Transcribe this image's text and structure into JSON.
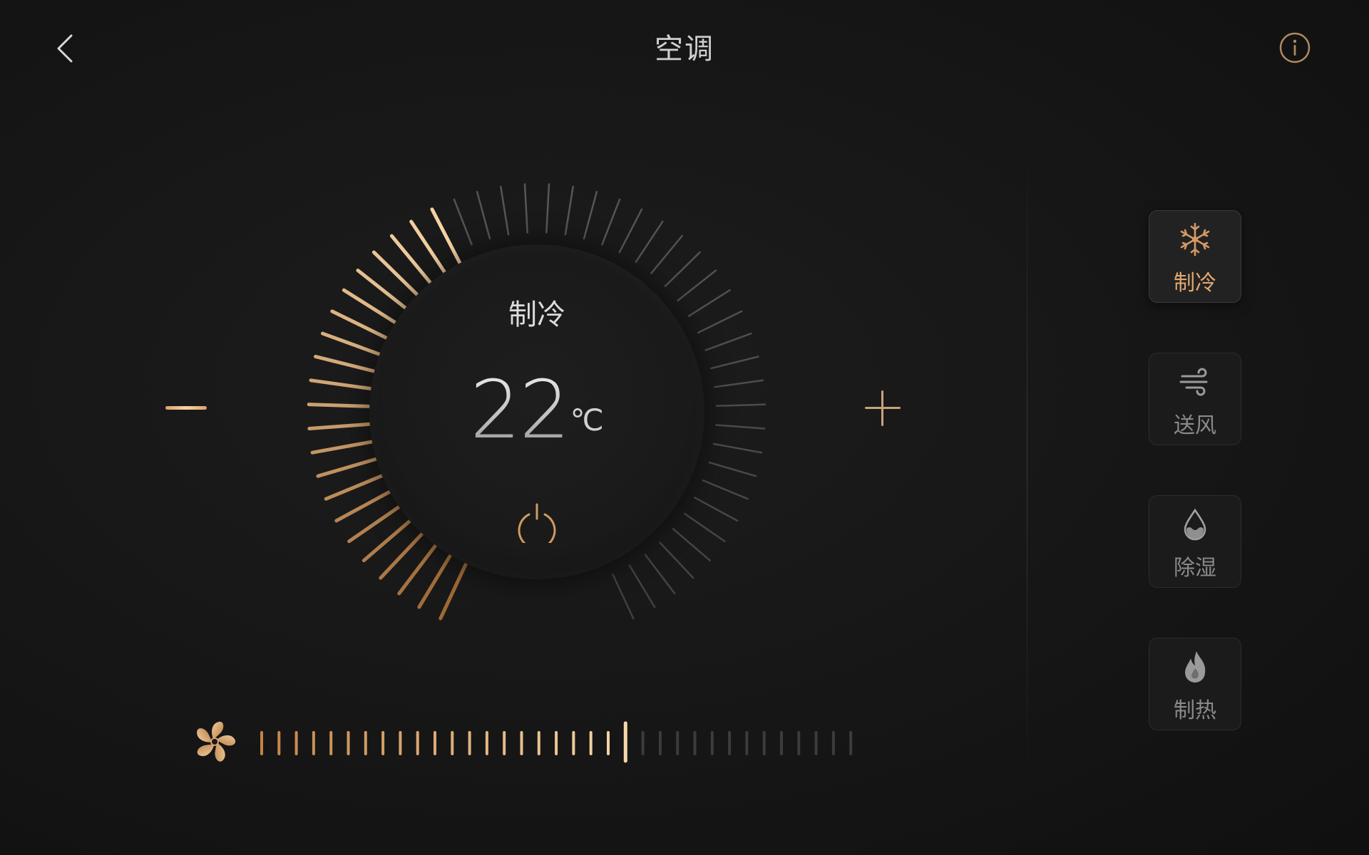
{
  "header": {
    "title": "空调",
    "back_icon": "chevron-left-icon",
    "info_icon": "info-icon"
  },
  "thermostat": {
    "mode_label": "制冷",
    "temperature": "22",
    "unit": "℃",
    "level_fraction": 0.42,
    "power_icon": "power-icon",
    "minus_icon": "minus-icon",
    "plus_icon": "plus-icon"
  },
  "modes": [
    {
      "label": "制冷",
      "icon": "snowflake-icon",
      "active": true
    },
    {
      "label": "送风",
      "icon": "wind-icon",
      "active": false
    },
    {
      "label": "除湿",
      "icon": "droplet-icon",
      "active": false
    },
    {
      "label": "制热",
      "icon": "flame-icon",
      "active": false
    }
  ],
  "fan": {
    "icon": "fan-icon",
    "level_fraction": 0.62
  },
  "colors": {
    "accent": "#e2a870",
    "accent_light": "#f6d3a4",
    "tick_inactive": "#4a4a4a",
    "background": "#161616"
  }
}
